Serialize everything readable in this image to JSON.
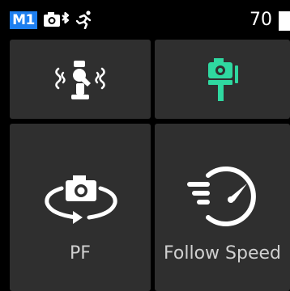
{
  "status_bar": {
    "mode": "M1",
    "battery_value": "70",
    "icons": [
      "camera-bluetooth-icon",
      "running-person-icon",
      "battery-icon"
    ]
  },
  "tiles": [
    {
      "label": "",
      "icon": "gimbal-calibration-icon",
      "icon_color": "#ffffff"
    },
    {
      "label": "",
      "icon": "camera-on-pole-icon",
      "icon_color": "#2fd8a0"
    },
    {
      "label": "PF",
      "icon": "camera-rotate-icon",
      "icon_color": "#ffffff"
    },
    {
      "label": "Follow Speed",
      "icon": "speedometer-icon",
      "icon_color": "#ffffff"
    }
  ],
  "colors": {
    "background": "#000000",
    "tile": "#2f2f2f",
    "accent_green": "#2fd8a0",
    "mode_badge": "#1e7ff0"
  }
}
